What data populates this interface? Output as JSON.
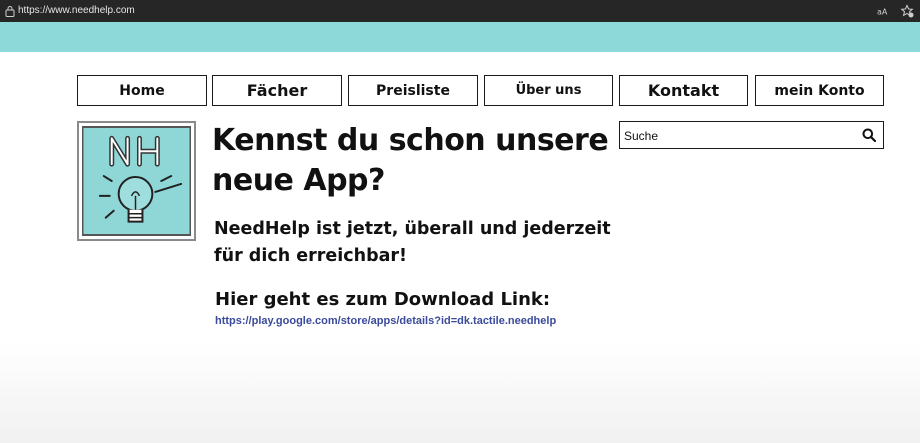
{
  "browser": {
    "url": "https://www.needhelp.com",
    "icons": [
      "lock-icon",
      "reader-view-icon",
      "favorite-icon"
    ]
  },
  "colors": {
    "topband": "#8dd8d9",
    "link": "#3a4a9c"
  },
  "nav": {
    "items": [
      {
        "label": "Home"
      },
      {
        "label": "Fächer"
      },
      {
        "label": "Preisliste"
      },
      {
        "label": "Über uns"
      },
      {
        "label": "Kontakt"
      },
      {
        "label": "mein Konto"
      }
    ]
  },
  "logo": {
    "text": "NH",
    "icon": "lightbulb-icon"
  },
  "main": {
    "headline": "Kennst du schon unsere neue App?",
    "subline": "NeedHelp ist jetzt, überall und jederzeit für dich erreichbar!",
    "download_title": "Hier geht es zum Download Link:",
    "download_link": "https://play.google.com/store/apps/details?id=dk.tactile.needhelp"
  },
  "search": {
    "placeholder": "Suche",
    "value": "",
    "icon": "search-icon"
  }
}
